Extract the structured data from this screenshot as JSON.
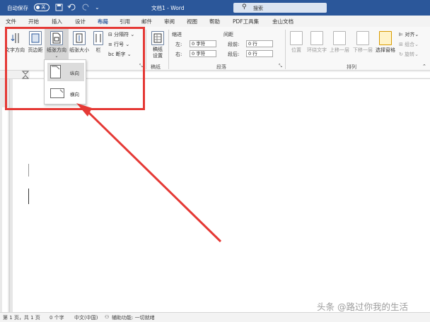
{
  "titlebar": {
    "autosave_label": "自动保存",
    "autosave_state": "关",
    "doc_title": "文档1 - Word",
    "search_placeholder": "搜索",
    "quick_icons": [
      "save-icon",
      "undo-icon",
      "redo-icon"
    ]
  },
  "tabs": [
    "文件",
    "开始",
    "插入",
    "设计",
    "布局",
    "引用",
    "邮件",
    "审阅",
    "视图",
    "帮助",
    "PDF工具集",
    "金山文档"
  ],
  "active_tab": "布局",
  "ribbon": {
    "page_setup": {
      "text_direction": "文字方向",
      "margins": "页边距",
      "orientation": "纸张方向",
      "size": "纸张大小",
      "columns": "栏",
      "breaks": "分隔符",
      "line_numbers": "行号",
      "hyphenation": "断字"
    },
    "draft": {
      "label": "稿纸设置",
      "group": "稿纸"
    },
    "paragraph": {
      "indent_label": "缩进",
      "spacing_label": "间距",
      "left_label": "左:",
      "right_label": "右:",
      "before_label": "段前:",
      "after_label": "段后:",
      "left_value": "0 字符",
      "right_value": "0 字符",
      "before_value": "0 行",
      "after_value": "0 行",
      "group": "段落"
    },
    "arrange": {
      "position": "位置",
      "wrap_text": "环绕文字",
      "bring_forward": "上移一层",
      "send_backward": "下移一层",
      "selection_pane": "选择窗格",
      "align": "对齐",
      "group_objects": "组合",
      "rotate": "旋转",
      "group": "排列"
    }
  },
  "orientation_menu": {
    "portrait": "纵向",
    "landscape": "横向"
  },
  "status": {
    "page": "第 1 页，共 1 页",
    "words": "0 个字",
    "language": "中文(中国)",
    "accessibility": "辅助功能: 一切就绪"
  },
  "watermark": "头条 @路过你我的生活",
  "colors": {
    "brand": "#2b579a",
    "highlight": "#e53935"
  }
}
